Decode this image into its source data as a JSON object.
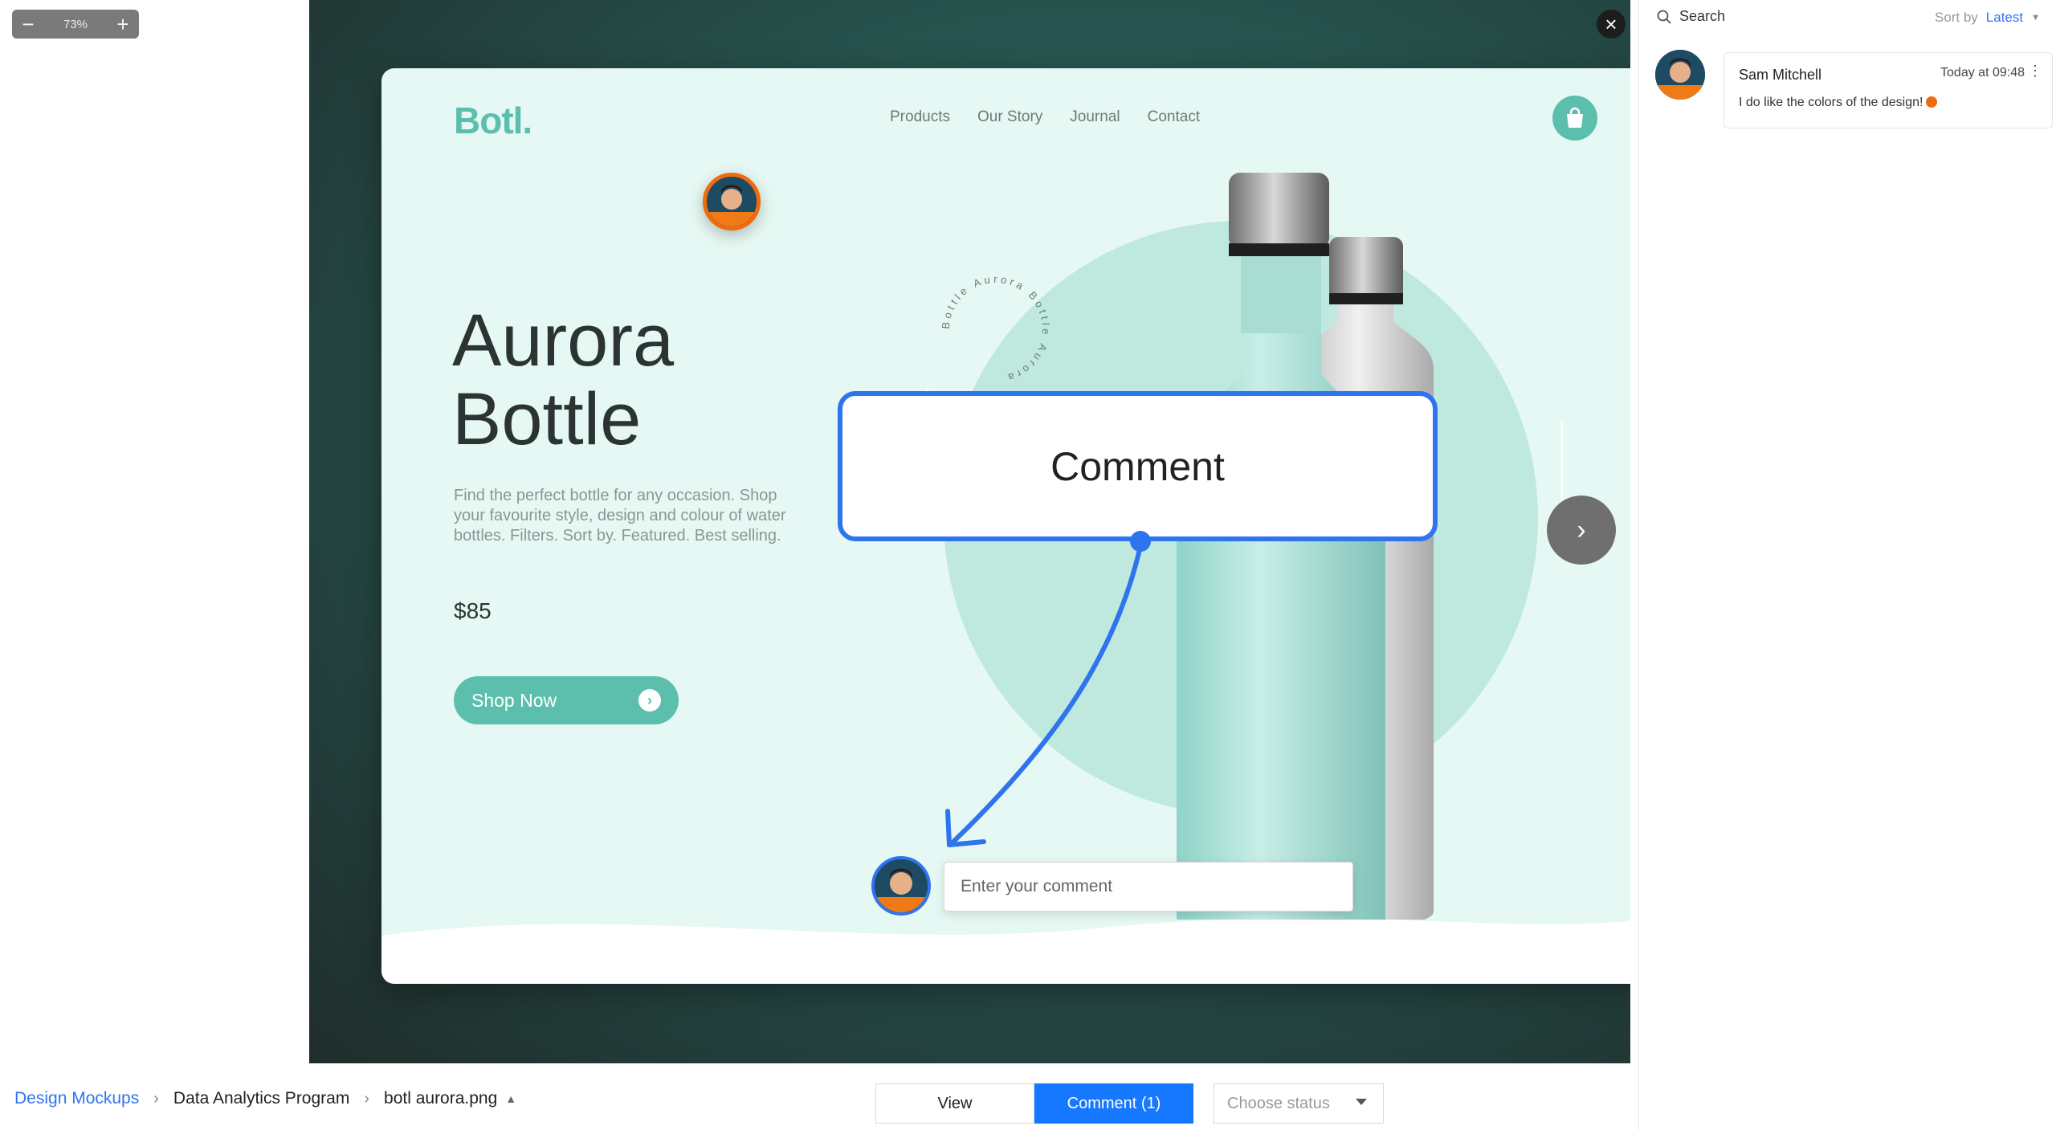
{
  "zoom": {
    "minus": "−",
    "value": "73%",
    "plus": "+"
  },
  "mockup": {
    "logo": "Botl.",
    "nav": [
      "Products",
      "Our Story",
      "Journal",
      "Contact"
    ],
    "headline_line1": "Aurora",
    "headline_line2": "Bottle",
    "description": "Find the perfect bottle for any occasion. Shop your favourite style, design and colour of water bottles. Filters. Sort by. Featured. Best selling.",
    "price": "$85",
    "shop_button": "Shop Now",
    "ring_text": "Bottle Aurora Bottle Aurora",
    "accent": "#5cbfae"
  },
  "overlay": {
    "comment_label": "Comment",
    "input_placeholder": "Enter your comment",
    "accent": "#2f74ef"
  },
  "panel": {
    "search_label": "Search",
    "sort_label": "Sort by",
    "sort_value": "Latest",
    "comments": [
      {
        "author": "Sam Mitchell",
        "time": "Today at 09:48",
        "text": "I do like the colors of the design!"
      }
    ]
  },
  "bottom": {
    "breadcrumb": [
      "Design Mockups",
      "Data Analytics Program",
      "botl aurora.png"
    ],
    "view_label": "View",
    "comment_tab_label": "Comment (1)",
    "status_placeholder": "Choose status"
  }
}
